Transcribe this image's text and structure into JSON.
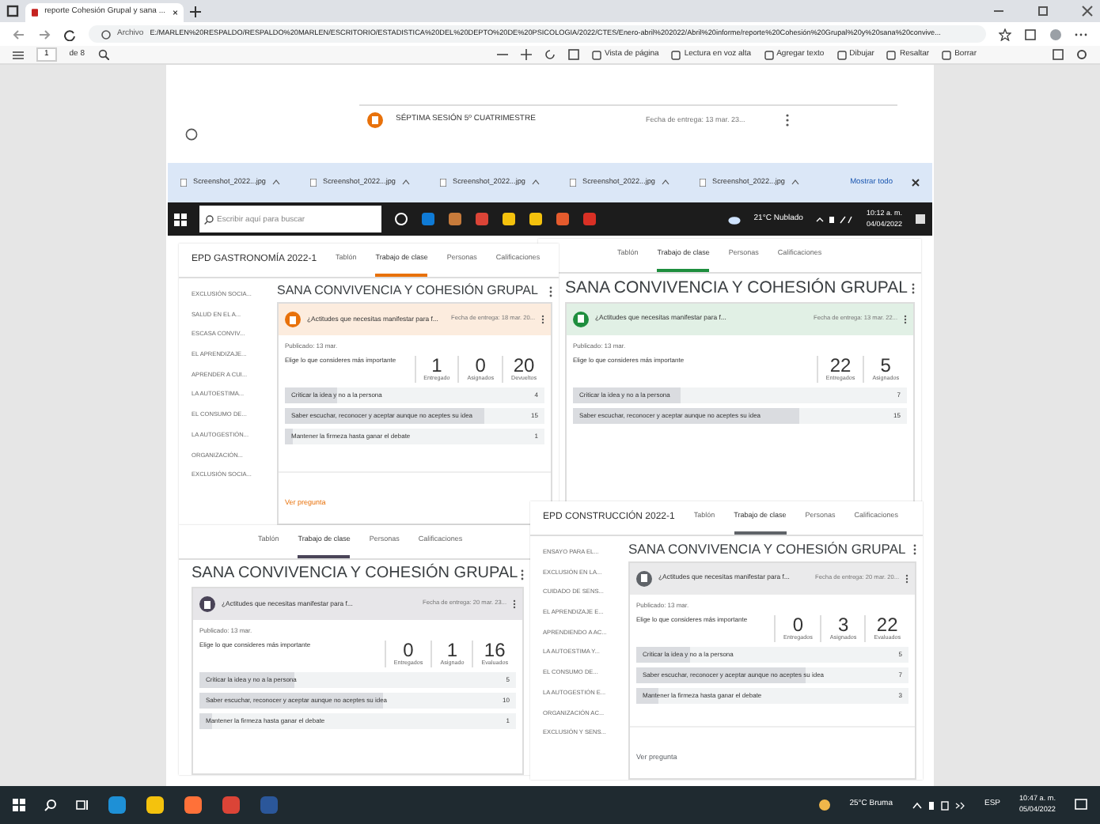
{
  "browser": {
    "tab_title": "reporte Cohesión Grupal y sana ...",
    "address_prefix": "Archivo",
    "url": "E:/MARLEN%20RESPALDO/RESPALDO%20MARLEN/ESCRITORIO/ESTADISTICA%20DEL%20DEPTO%20DE%20PSICOLOGIA/2022/CTES/Enero-abril%202022/Abril%20informe/reporte%20Cohesión%20Grupal%20y%20sana%20convive..."
  },
  "pdf_toolbar": {
    "page": "1",
    "page_count": "de 8",
    "buttons": [
      "Vista de página",
      "Lectura en voz alta",
      "Agregar texto",
      "Dibujar",
      "Resaltar",
      "Borrar"
    ]
  },
  "page_top": {
    "assignment": "SÉPTIMA SESIÓN 5º CUATRIMESTRE",
    "due": "Fecha de entrega: 13 mar. 23..."
  },
  "downloads": {
    "items": [
      "Screenshot_2022...jpg",
      "Screenshot_2022...jpg",
      "Screenshot_2022...jpg",
      "Screenshot_2022...jpg",
      "Screenshot_2022...jpg"
    ],
    "show_all": "Mostrar todo"
  },
  "inner_taskbar": {
    "search_placeholder": "Escribir aquí para buscar",
    "weather": "21°C Nublado",
    "time": "10:12 a. m.",
    "date": "04/04/2022"
  },
  "panels": [
    {
      "course": "EPD GASTRONOMÍA 2022-1",
      "tabs": [
        {
          "label": "Tablón",
          "selected": false
        },
        {
          "label": "Trabajo de clase",
          "selected": true
        },
        {
          "label": "Personas",
          "selected": false
        },
        {
          "label": "Calificaciones",
          "selected": false
        }
      ],
      "sidebar": [
        "EXCLUSIÓN SOCIA...",
        "SALUD EN EL A...",
        "ESCASA CONVIV...",
        "EL APRENDIZAJE...",
        "APRENDER A CUI...",
        "LA AUTOESTIMA...",
        "EL CONSUMO DE...",
        "LA AUTOGESTIÓN...",
        "ORGANIZACIÓN...",
        "EXCLUSIÓN SOCIA..."
      ],
      "heading": "SANA CONVIVENCIA Y COHESIÓN GRUPAL",
      "color": "#e8710a",
      "activity": "¿Actitudes que necesitas manifestar para f...",
      "due": "Fecha de entrega: 18 mar. 20...",
      "published": "Publicado: 13 mar.",
      "question": "Elige lo que consideres más importante",
      "stats": [
        {
          "value": "1",
          "label": "Entregado"
        },
        {
          "value": "0",
          "label": "Asignados"
        },
        {
          "value": "20",
          "label": "Devueltos"
        }
      ],
      "options": [
        {
          "text": "Criticar la idea y no a la persona",
          "count": "4",
          "level": 0.2
        },
        {
          "text": "Saber escuchar, reconocer y aceptar aunque no aceptes su idea",
          "count": "15",
          "level": 0.77
        },
        {
          "text": "Mantener la firmeza hasta ganar el debate",
          "count": "1",
          "level": 0.03
        }
      ],
      "footer": "Ver pregunta"
    },
    {
      "tabs": [
        {
          "label": "Tablón",
          "selected": false
        },
        {
          "label": "Trabajo de clase",
          "selected": true
        },
        {
          "label": "Personas",
          "selected": false
        },
        {
          "label": "Calificaciones",
          "selected": false
        }
      ],
      "heading": "SANA CONVIVENCIA Y COHESIÓN GRUPAL",
      "color": "#1e8e3e",
      "activity": "¿Actitudes que necesitas manifestar para f...",
      "due": "Fecha de entrega: 13 mar. 22...",
      "published": "Publicado: 13 mar.",
      "question": "Elige lo que consideres más importante",
      "stats": [
        {
          "value": "22",
          "label": "Entregados"
        },
        {
          "value": "5",
          "label": "Asignados"
        }
      ],
      "options": [
        {
          "text": "Criticar la idea y no a la persona",
          "count": "7",
          "level": 0.32
        },
        {
          "text": "Saber escuchar, reconocer y aceptar aunque no aceptes su idea",
          "count": "15",
          "level": 0.68
        }
      ]
    },
    {
      "tabs": [
        {
          "label": "Tablón",
          "selected": false
        },
        {
          "label": "Trabajo de clase",
          "selected": true
        },
        {
          "label": "Personas",
          "selected": false
        },
        {
          "label": "Calificaciones",
          "selected": false
        }
      ],
      "heading": "SANA CONVIVENCIA Y COHESIÓN GRUPAL",
      "color": "#4a4458",
      "activity": "¿Actitudes que necesitas manifestar para f...",
      "due": "Fecha de entrega: 20 mar. 23...",
      "published": "Publicado: 13 mar.",
      "question": "Elige lo que consideres más importante",
      "stats": [
        {
          "value": "0",
          "label": "Entregados"
        },
        {
          "value": "1",
          "label": "Asignado"
        },
        {
          "value": "16",
          "label": "Evaluados"
        }
      ],
      "options": [
        {
          "text": "Criticar la idea y no a la persona",
          "count": "5",
          "level": 0.3
        },
        {
          "text": "Saber escuchar, reconocer y aceptar aunque no aceptes su idea",
          "count": "10",
          "level": 0.58
        },
        {
          "text": "Mantener la firmeza hasta ganar el debate",
          "count": "1",
          "level": 0.04
        }
      ]
    },
    {
      "course": "EPD CONSTRUCCIÓN 2022-1",
      "tabs": [
        {
          "label": "Tablón",
          "selected": false
        },
        {
          "label": "Trabajo de clase",
          "selected": true
        },
        {
          "label": "Personas",
          "selected": false
        },
        {
          "label": "Calificaciones",
          "selected": false
        }
      ],
      "sidebar": [
        "ENSAYO PARA EL...",
        "EXCLUSIÓN EN LA...",
        "CUIDADO DE SENS...",
        "EL APRENDIZAJE E...",
        "APRENDIENDO A AC...",
        "LA AUTOESTIMA Y...",
        "EL CONSUMO DE...",
        "LA AUTOGESTIÓN E...",
        "ORGANIZACIÓN AC...",
        "EXCLUSIÓN Y SENS..."
      ],
      "heading": "SANA CONVIVENCIA Y COHESIÓN GRUPAL",
      "color": "#5f6368",
      "activity": "¿Actitudes que necesitas manifestar para f...",
      "due": "Fecha de entrega: 20 mar. 20...",
      "published": "Publicado: 13 mar.",
      "question": "Elige lo que consideres más importante",
      "stats": [
        {
          "value": "0",
          "label": "Entregados"
        },
        {
          "value": "3",
          "label": "Asignados"
        },
        {
          "value": "22",
          "label": "Evaluados"
        }
      ],
      "options": [
        {
          "text": "Criticar la idea y no a la persona",
          "count": "5",
          "level": 0.2
        },
        {
          "text": "Saber escuchar, reconocer y aceptar aunque no aceptes su idea",
          "count": "7",
          "level": 0.62
        },
        {
          "text": "Mantener la firmeza hasta ganar el debate",
          "count": "3",
          "level": 0.08
        }
      ],
      "footer": "Ver pregunta"
    }
  ],
  "taskbar": {
    "weather": "25°C Bruma",
    "language": "ESP",
    "time": "10:47 a. m.",
    "date": "05/04/2022"
  }
}
